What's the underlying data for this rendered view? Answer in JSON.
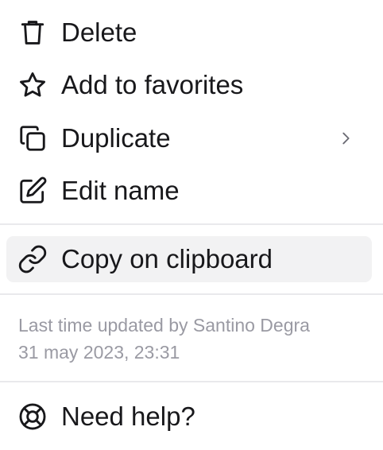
{
  "menu": {
    "items": [
      {
        "label": "Delete",
        "icon": "trash-icon"
      },
      {
        "label": "Add to favorites",
        "icon": "star-icon"
      },
      {
        "label": "Duplicate",
        "icon": "duplicate-icon",
        "has_submenu": true
      },
      {
        "label": "Edit name",
        "icon": "edit-icon"
      }
    ],
    "copy": {
      "label": "Copy on clipboard",
      "icon": "link-icon",
      "highlighted": true
    },
    "meta": {
      "updated_by": "Last time updated by Santino Degra",
      "updated_at": "31 may 2023, 23:31"
    },
    "help": {
      "label": "Need help?",
      "icon": "lifebuoy-icon"
    }
  }
}
